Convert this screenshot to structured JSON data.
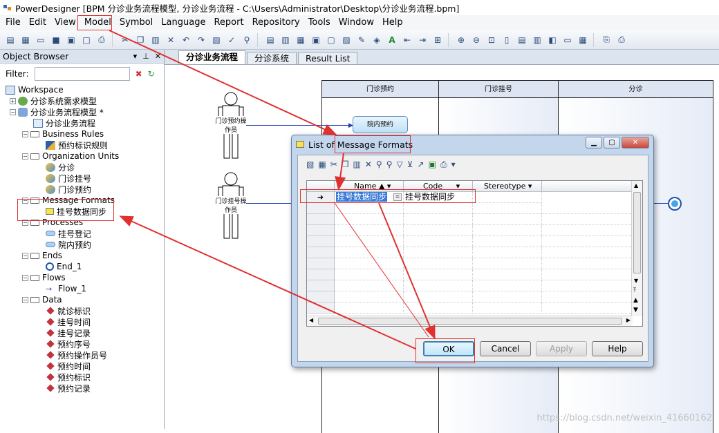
{
  "window": {
    "title": "PowerDesigner [BPM 分诊业务流程模型, 分诊业务流程 - C:\\Users\\Administrator\\Desktop\\分诊业务流程.bpm]"
  },
  "menu": [
    "File",
    "Edit",
    "View",
    "Model",
    "Symbol",
    "Language",
    "Report",
    "Repository",
    "Tools",
    "Window",
    "Help"
  ],
  "object_browser": {
    "title": "Object Browser",
    "filter_label": "Filter:",
    "tree": {
      "workspace": "Workspace",
      "model1": "分诊系统需求模型",
      "model2": "分诊业务流程模型 *",
      "diagram": "分诊业务流程",
      "business_rules": "Business Rules",
      "rule1": "预约标识规则",
      "org_units": "Organization Units",
      "org1": "分诊",
      "org2": "门诊挂号",
      "org3": "门诊预约",
      "message_formats": "Message Formats",
      "msg1": "挂号数据同步",
      "processes": "Processes",
      "proc1": "挂号登记",
      "proc2": "院内预约",
      "ends": "Ends",
      "end1": "End_1",
      "flows": "Flows",
      "flow1": "Flow_1",
      "data": "Data",
      "data_items": [
        "就诊标识",
        "挂号时间",
        "挂号记录",
        "预约序号",
        "预约操作员号",
        "预约时间",
        "预约标识",
        "预约记录"
      ]
    }
  },
  "tabs": [
    "分诊业务流程",
    "分诊系统",
    "Result List"
  ],
  "diagram": {
    "lanes": [
      "门诊预约",
      "门诊挂号",
      "分诊"
    ],
    "actor1": "门诊预约操作员",
    "actor2": "门诊挂号操作员",
    "process": "院内预约"
  },
  "dialog": {
    "title": "List of Message Formats",
    "columns": [
      "Name",
      "Code",
      "Stereotype"
    ],
    "row": {
      "name": "挂号数据同步",
      "code": "挂号数据同步",
      "stereotype": ""
    },
    "buttons": {
      "ok": "OK",
      "cancel": "Cancel",
      "apply": "Apply",
      "help": "Help"
    }
  },
  "watermark": "https://blog.csdn.net/weixin_41660162"
}
